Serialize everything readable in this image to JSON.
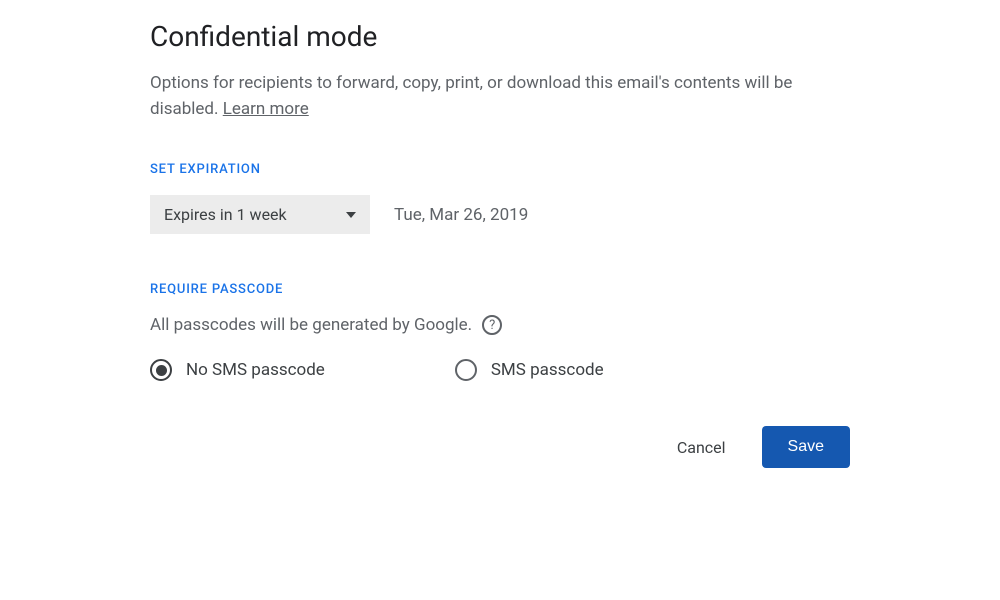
{
  "dialog": {
    "title": "Confidential mode",
    "description_prefix": "Options for recipients to forward, copy, print, or download this email's contents will be disabled. ",
    "learn_more": "Learn more"
  },
  "expiration": {
    "section_label": "SET EXPIRATION",
    "dropdown_value": "Expires in 1 week",
    "date": "Tue, Mar 26, 2019"
  },
  "passcode": {
    "section_label": "REQUIRE PASSCODE",
    "description": "All passcodes will be generated by Google.",
    "help_symbol": "?",
    "options": {
      "no_sms": "No SMS passcode",
      "sms": "SMS passcode"
    }
  },
  "actions": {
    "cancel": "Cancel",
    "save": "Save"
  }
}
